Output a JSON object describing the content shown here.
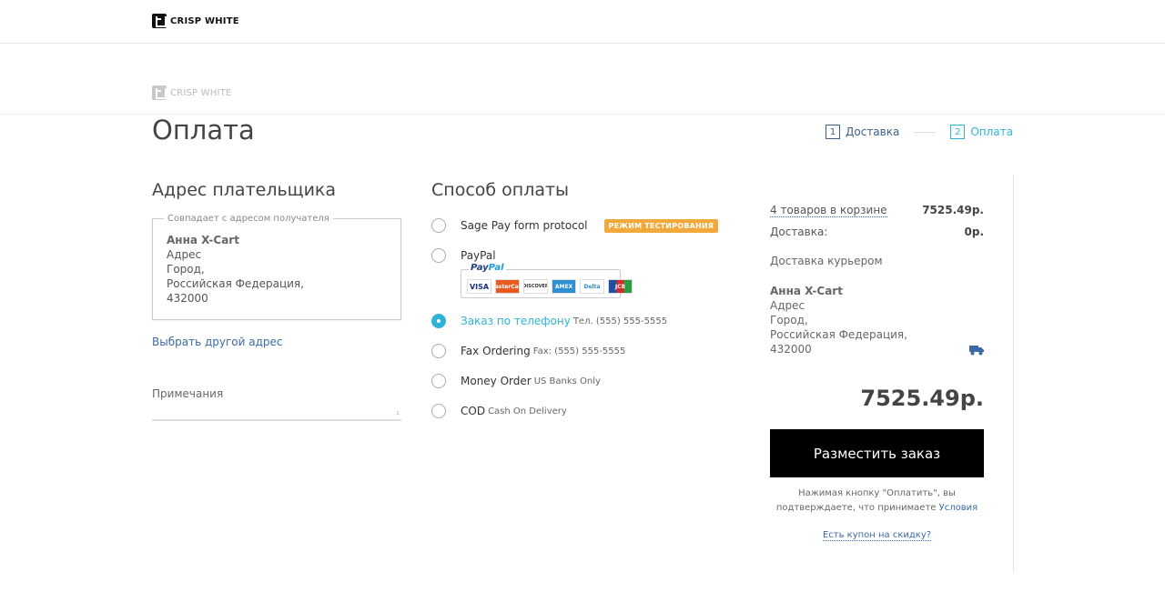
{
  "brand": {
    "name": "CRISP WHITE",
    "logo_icon": "store-logo-icon"
  },
  "page": {
    "title": "Оплата"
  },
  "steps": [
    {
      "number": "1",
      "label": "Доставка"
    },
    {
      "number": "2",
      "label": "Оплата"
    }
  ],
  "billing": {
    "title": "Адрес плательщика",
    "same_as_label": "Совпадает с адресом получателя",
    "name": "Анна X-Cart",
    "line1": "Адрес",
    "line2": "Город,",
    "line3": "Российская Федерация,",
    "line4": "432000",
    "change_link": "Выбрать другой адрес",
    "notes_label": "Примечания",
    "notes_value": ""
  },
  "payment": {
    "title": "Способ оплаты",
    "methods": [
      {
        "name": "Sage Pay form protocol",
        "note": "",
        "badge": "РЕЖИМ ТЕСТИРОВАНИЯ",
        "selected": false
      },
      {
        "name": "PayPal",
        "note": "",
        "badge": "",
        "selected": false
      },
      {
        "name": "Заказ по телефону",
        "note": "Тел. (555) 555-5555",
        "badge": "",
        "selected": true
      },
      {
        "name": "Fax Ordering",
        "note": "Fax: (555) 555-5555",
        "badge": "",
        "selected": false
      },
      {
        "name": "Money Order",
        "note": "US Banks Only",
        "badge": "",
        "selected": false
      },
      {
        "name": "COD",
        "note": "Cash On Delivery",
        "badge": "",
        "selected": false
      }
    ],
    "paypal": {
      "logo_a": "Pay",
      "logo_b": "Pal",
      "cards": [
        "VISA",
        "MasterCard",
        "DISCOVER",
        "AMEX",
        "Delta",
        "JCB"
      ]
    }
  },
  "summary": {
    "cart_link": "4 товаров в корзине",
    "subtotal": "7525.49р.",
    "shipping_label": "Доставка:",
    "shipping_value": "0р.",
    "shipping_method": "Доставка курьером",
    "ship_name": "Анна X-Cart",
    "ship_line1": "Адрес",
    "ship_line2": "Город,",
    "ship_line3": "Российская Федерация,",
    "ship_line4": "432000",
    "truck_icon": "truck-icon",
    "total": "7525.49р.",
    "place_order": "Разместить заказ",
    "agree_text": "Нажимая кнопку \"Оплатить\", вы подтверждаете, что принимаете",
    "terms_link": "Условия",
    "coupon_link": "Есть купон на скидку?"
  },
  "colors": {
    "accent": "#2fb4d6",
    "link": "#3b6aa6",
    "badge": "#f2a93b",
    "button": "#000000"
  }
}
